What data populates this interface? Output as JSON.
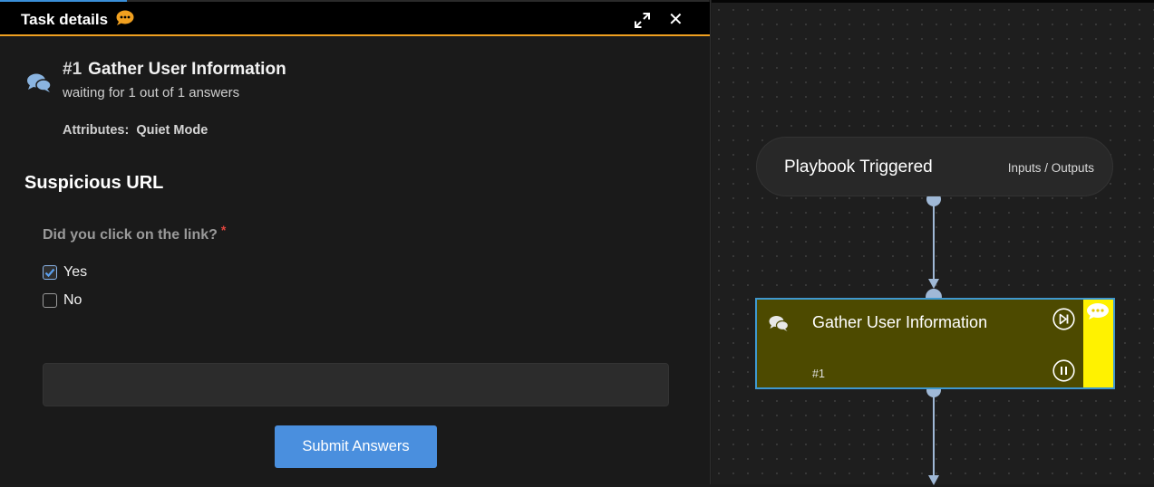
{
  "task_panel": {
    "title": "Task details",
    "task_number": "#1",
    "task_name": "Gather User Information",
    "status": "waiting for 1 out of 1 answers",
    "attributes_label": "Attributes:",
    "attributes_value": "Quiet Mode"
  },
  "form": {
    "section_title": "Suspicious URL",
    "question": "Did you click on the link?",
    "required_marker": "*",
    "options": [
      {
        "label": "Yes",
        "checked": true
      },
      {
        "label": "No",
        "checked": false
      }
    ],
    "answer_value": "",
    "submit_label": "Submit Answers"
  },
  "canvas": {
    "trigger_node": {
      "title": "Playbook Triggered",
      "io_link": "Inputs / Outputs"
    },
    "task_node": {
      "title": "Gather User Information",
      "number": "#1",
      "fill_color": "#4d4a00",
      "border_color": "#3f98cf",
      "flag_color": "#fff200"
    }
  },
  "colors": {
    "header_accent": "#f0a020",
    "submit_button": "#4a8fde",
    "required": "#e0453e"
  }
}
